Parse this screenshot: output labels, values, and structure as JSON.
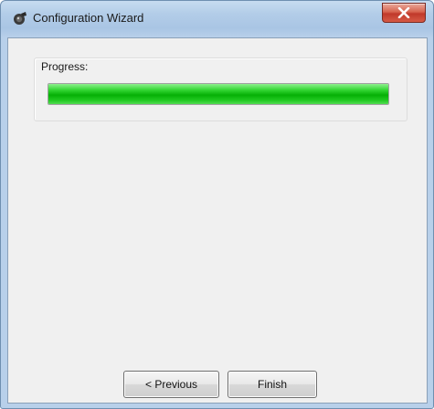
{
  "window": {
    "title": "Configuration Wizard",
    "close_symbol": "X"
  },
  "progress": {
    "label": "Progress:",
    "value_percent": 100,
    "bar_color": "#22c922"
  },
  "buttons": {
    "previous_label": "< Previous",
    "finish_label": "Finish"
  },
  "icons": {
    "app": "wizard-app-icon",
    "close": "close-icon"
  }
}
